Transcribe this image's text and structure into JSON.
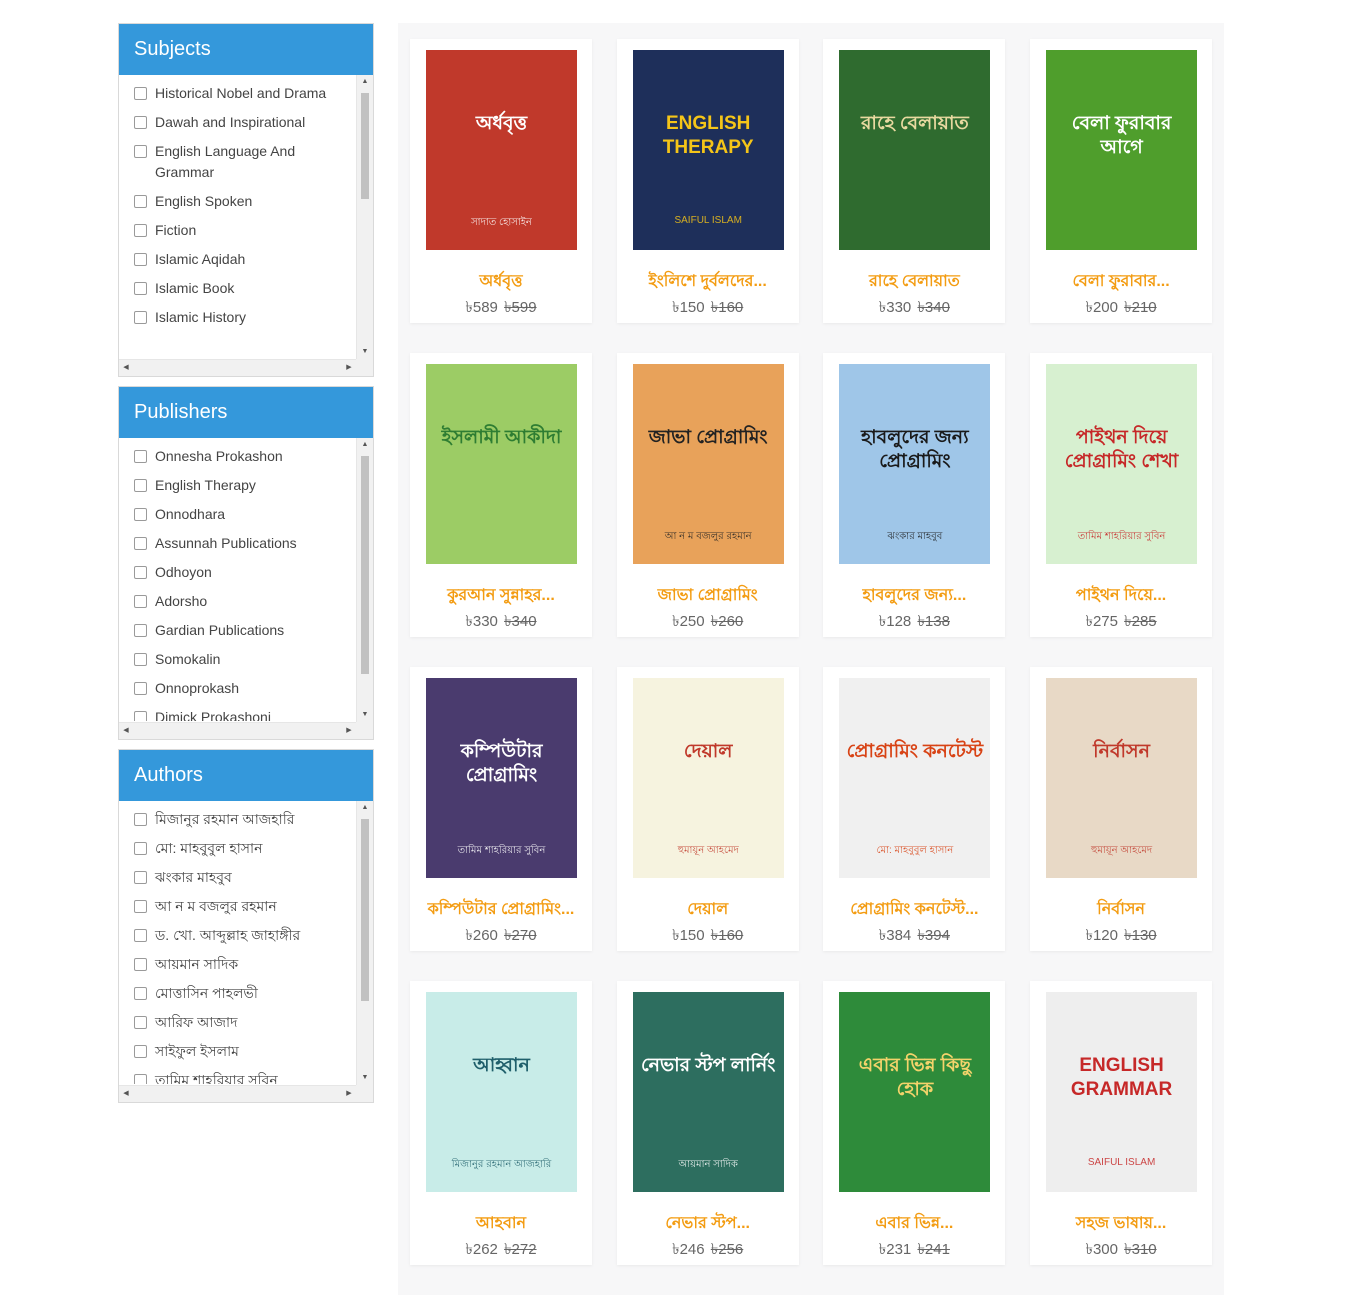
{
  "filters": {
    "subjects": {
      "title": "Subjects",
      "items": [
        "Historical Nobel and Drama",
        "Dawah and Inspirational",
        "English Language And Grammar",
        "English Spoken",
        "Fiction",
        "Islamic Aqidah",
        "Islamic Book",
        "Islamic History"
      ]
    },
    "publishers": {
      "title": "Publishers",
      "items": [
        "Onnesha Prokashon",
        "English Therapy",
        "Onnodhara",
        "Assunnah Publications",
        "Odhoyon",
        "Adorsho",
        "Gardian Publications",
        "Somokalin",
        "Onnoprokash",
        "Dimick Prokashoni"
      ]
    },
    "authors": {
      "title": "Authors",
      "items": [
        "মিজানুর রহমান আজহারি",
        "মো: মাহবুবুল হাসান",
        "ঝংকার মাহবুব",
        "আ ন ম বজলুর রহমান",
        "ড. খো. আব্দুল্লাহ জাহাঙ্গীর",
        "আয়মান সাদিক",
        "মোত্তাসিন পাহলভী",
        "আরিফ আজাদ",
        "সাইফুল ইসলাম",
        "তামিম শাহরিয়ার সুবিন"
      ]
    }
  },
  "currency": "৳",
  "books": [
    {
      "title": "অর্ধবৃত্ত",
      "price": "৳589",
      "old_price": "৳599",
      "cover_title": "অর্ধবৃত্ত",
      "cover_sub": "সাদাত হোসাইন",
      "cover_bg": "#c0392b",
      "cover_fg": "#ffffff"
    },
    {
      "title": "ইংলিশে দুর্বলদের...",
      "price": "৳150",
      "old_price": "৳160",
      "cover_title": "ENGLISH THERAPY",
      "cover_sub": "SAIFUL ISLAM",
      "cover_bg": "#1e2f5a",
      "cover_fg": "#f5c518"
    },
    {
      "title": "রাহে বেলায়াত",
      "price": "৳330",
      "old_price": "৳340",
      "cover_title": "রাহে বেলায়াত",
      "cover_sub": "",
      "cover_bg": "#2f6b2f",
      "cover_fg": "#e8d9a0"
    },
    {
      "title": "বেলা ফুরাবার...",
      "price": "৳200",
      "old_price": "৳210",
      "cover_title": "বেলা ফুরাবার আগে",
      "cover_sub": "",
      "cover_bg": "#4f9e2c",
      "cover_fg": "#ffffff"
    },
    {
      "title": "কুরআন সুন্নাহর...",
      "price": "৳330",
      "old_price": "৳340",
      "cover_title": "ইসলামী আকীদা",
      "cover_sub": "",
      "cover_bg": "#9ccc65",
      "cover_fg": "#2e7d32"
    },
    {
      "title": "জাভা প্রোগ্রামিং",
      "price": "৳250",
      "old_price": "৳260",
      "cover_title": "জাভা প্রোগ্রামিং",
      "cover_sub": "আ ন ম বজলুর রহমান",
      "cover_bg": "#e8a25a",
      "cover_fg": "#222222"
    },
    {
      "title": "হাবলুদের জন্য...",
      "price": "৳128",
      "old_price": "৳138",
      "cover_title": "হাবলুদের জন্য প্রোগ্রামিং",
      "cover_sub": "ঝংকার মাহবুব",
      "cover_bg": "#9fc6e8",
      "cover_fg": "#1a1a1a"
    },
    {
      "title": "পাইথন দিয়ে...",
      "price": "৳275",
      "old_price": "৳285",
      "cover_title": "পাইথন দিয়ে প্রোগ্রামিং শেখা",
      "cover_sub": "তামিম শাহরিয়ার সুবিন",
      "cover_bg": "#d7f0d0",
      "cover_fg": "#c62828"
    },
    {
      "title": "কম্পিউটার প্রোগ্রামিং...",
      "price": "৳260",
      "old_price": "৳270",
      "cover_title": "কম্পিউটার প্রোগ্রামিং",
      "cover_sub": "তামিম শাহরিয়ার সুবিন",
      "cover_bg": "#4a3b6e",
      "cover_fg": "#ffffff"
    },
    {
      "title": "দেয়াল",
      "price": "৳150",
      "old_price": "৳160",
      "cover_title": "দেয়াল",
      "cover_sub": "হুমায়ূন আহমেদ",
      "cover_bg": "#f6f3df",
      "cover_fg": "#c0392b"
    },
    {
      "title": "প্রোগ্রামিং কনটেস্ট...",
      "price": "৳384",
      "old_price": "৳394",
      "cover_title": "প্রোগ্রামিং কনটেস্ট",
      "cover_sub": "মো: মাহবুবুল হাসান",
      "cover_bg": "#f0f0f0",
      "cover_fg": "#d84315"
    },
    {
      "title": "নির্বাসন",
      "price": "৳120",
      "old_price": "৳130",
      "cover_title": "নির্বাসন",
      "cover_sub": "হুমায়ূন আহমেদ",
      "cover_bg": "#e8d9c6",
      "cover_fg": "#c0392b"
    },
    {
      "title": "আহবান",
      "price": "৳262",
      "old_price": "৳272",
      "cover_title": "আহ্বান",
      "cover_sub": "মিজানুর রহমান আজহারি",
      "cover_bg": "#c8ece8",
      "cover_fg": "#1f5f6b"
    },
    {
      "title": "নেভার স্টপ...",
      "price": "৳246",
      "old_price": "৳256",
      "cover_title": "নেভার স্টপ লার্নিং",
      "cover_sub": "আয়মান সাদিক",
      "cover_bg": "#2d6e5f",
      "cover_fg": "#ffffff"
    },
    {
      "title": "এবার ভিন্ন...",
      "price": "৳231",
      "old_price": "৳241",
      "cover_title": "এবার ভিন্ন কিছু হোক",
      "cover_sub": "",
      "cover_bg": "#2e8b3a",
      "cover_fg": "#f3d36b"
    },
    {
      "title": "সহজ ভাষায়...",
      "price": "৳300",
      "old_price": "৳310",
      "cover_title": "ENGLISH GRAMMAR",
      "cover_sub": "SAIFUL ISLAM",
      "cover_bg": "#eeeeee",
      "cover_fg": "#c62828"
    }
  ]
}
